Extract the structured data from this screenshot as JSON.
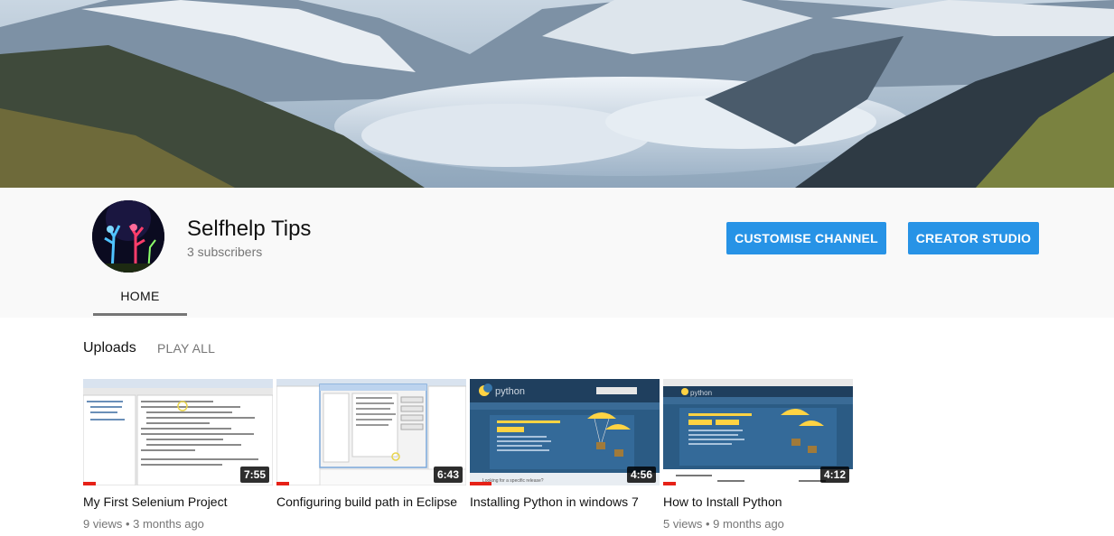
{
  "channel": {
    "name": "Selfhelp Tips",
    "subscribers": "3 subscribers",
    "customise_label": "CUSTOMISE CHANNEL",
    "studio_label": "CREATOR STUDIO",
    "tabs": [
      {
        "label": "HOME",
        "active": true
      }
    ]
  },
  "section": {
    "title": "Uploads",
    "play_all": "PLAY ALL"
  },
  "videos": [
    {
      "title": "My First Selenium Project",
      "duration": "7:55",
      "meta": "9 views • 3 months ago"
    },
    {
      "title": "Configuring build path in Eclipse",
      "duration": "6:43",
      "meta": ""
    },
    {
      "title": "Installing Python in windows 7",
      "duration": "4:56",
      "meta": ""
    },
    {
      "title": "How to Install Python",
      "duration": "4:12",
      "meta": "5 views • 9 months ago"
    }
  ],
  "colors": {
    "accent_button": "#2793e6",
    "progress_red": "#e62117",
    "header_bg": "#f9f9f9"
  }
}
